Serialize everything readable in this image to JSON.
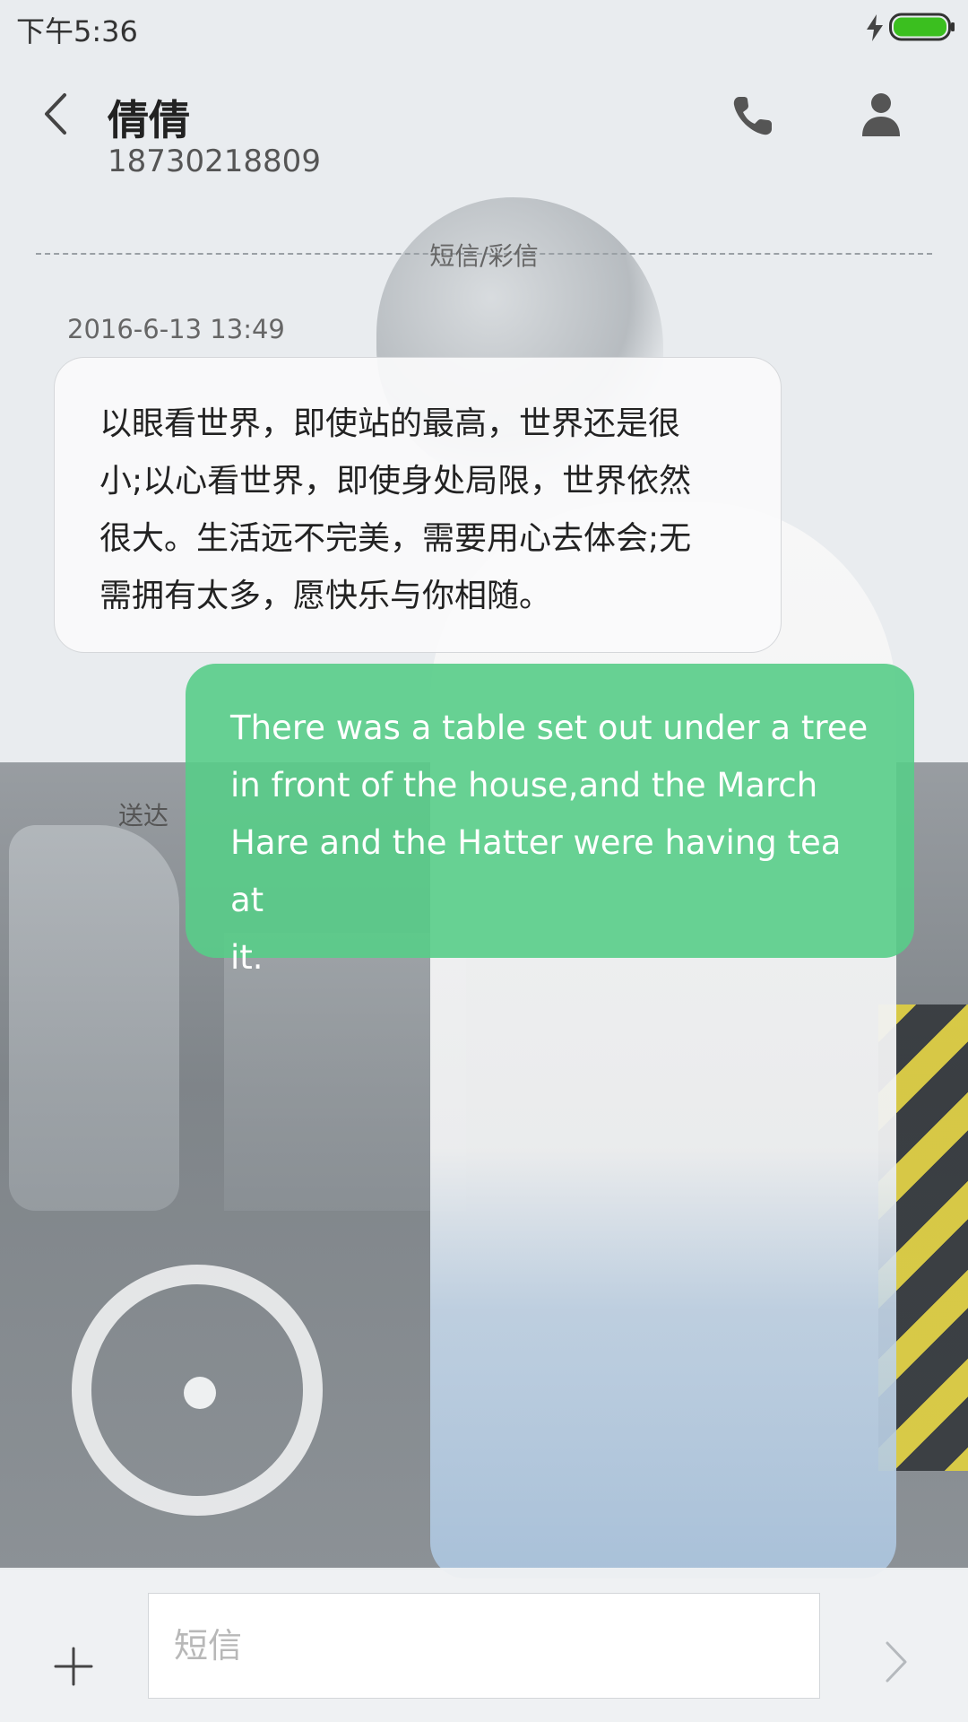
{
  "status_bar": {
    "time": "下午5:36",
    "battery_color": "#3bbf1f"
  },
  "header": {
    "contact_name": "倩倩",
    "contact_number": "18730218809",
    "icons": [
      "back-icon",
      "phone-icon",
      "person-icon"
    ]
  },
  "conversation": {
    "divider_label": "短信/彩信",
    "messages": [
      {
        "direction": "incoming",
        "timestamp": "2016-6-13 13:49",
        "lines": [
          "以眼看世界，即使站的最高，世界还是很",
          "小;以心看世界，即使身处局限，世界依然",
          "很大。生活远不完美，需要用心去体会;无",
          "需拥有太多，愿快乐与你相随。"
        ]
      },
      {
        "direction": "outgoing",
        "status": "送达",
        "lines": [
          "There was a table set out under a tree",
          "in front of the house,and the March",
          "Hare and the Hatter were having tea at",
          "it."
        ],
        "color": "#58cd88"
      }
    ]
  },
  "composer": {
    "placeholder": "短信",
    "icons": [
      "add-icon",
      "send-icon"
    ]
  }
}
